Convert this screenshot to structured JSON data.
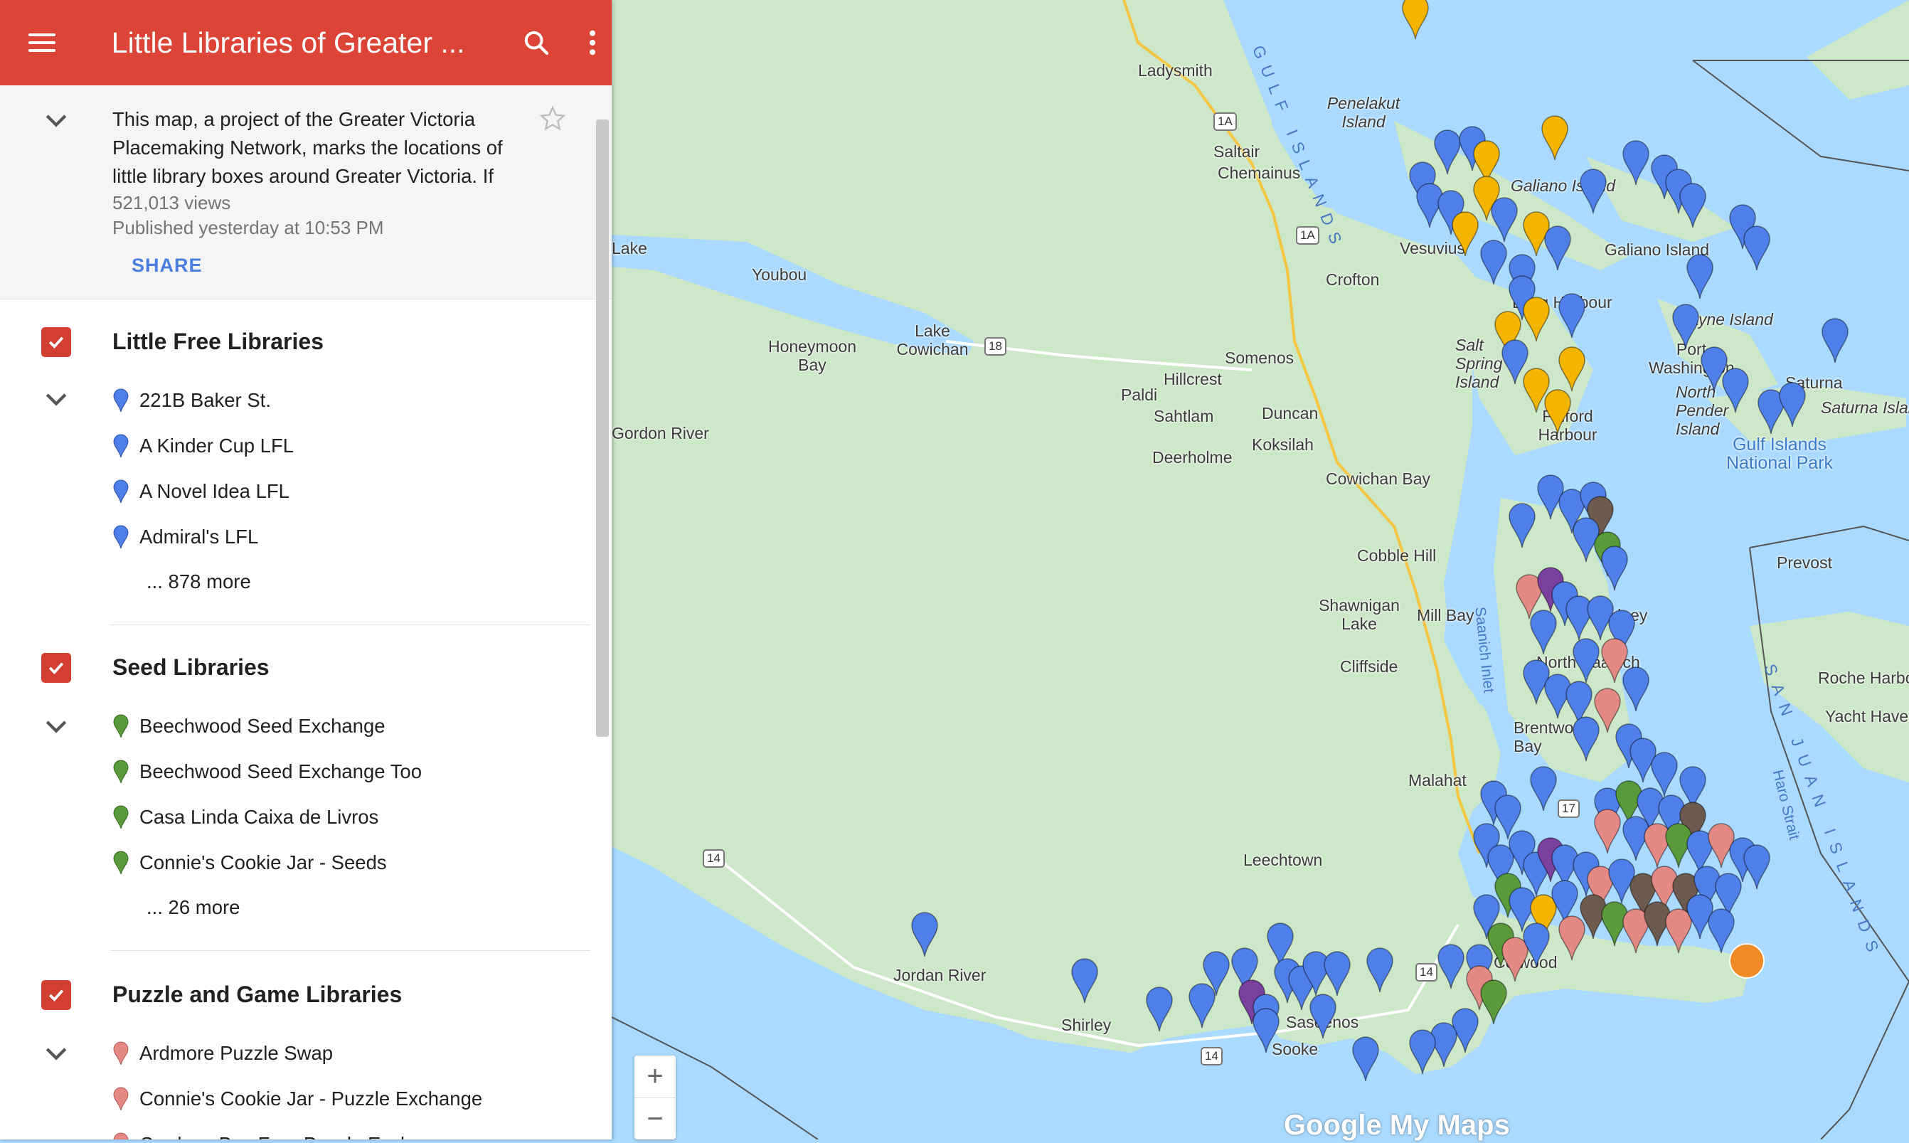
{
  "header": {
    "title": "Little Libraries of Greater ..."
  },
  "description": {
    "text": "This map, a project of the Greater Victoria Placemaking Network, marks the locations of little library boxes around Greater Victoria. If",
    "views": "521,013 views",
    "published": "Published yesterday at 10:53 PM",
    "share_label": "SHARE"
  },
  "layers": [
    {
      "name": "Little Free Libraries",
      "color": "#4f7fe8",
      "items": [
        "221B Baker St.",
        "A Kinder Cup LFL",
        "A Novel Idea LFL",
        "Admiral's LFL"
      ],
      "more": "... 878 more"
    },
    {
      "name": "Seed Libraries",
      "color": "#5a9a3a",
      "items": [
        "Beechwood Seed Exchange",
        "Beechwood Seed Exchange Too",
        "Casa Linda Caixa de Livros",
        "Connie's Cookie Jar - Seeds"
      ],
      "more": "... 26 more"
    },
    {
      "name": "Puzzle and Game Libraries",
      "color": "#e48a85",
      "items": [
        "Ardmore Puzzle Swap",
        "Connie's Cookie Jar - Puzzle Exchange",
        "Cordova Bay Free Puzzle Exchange"
      ]
    }
  ],
  "map_labels": {
    "ladysmith": "Ladysmith",
    "penelakut": "Penelakut Island",
    "gulf_islands": "GULF ISLANDS",
    "saltair": "Saltair",
    "chemainus": "Chemainus",
    "galiano_island": "Galiano Island",
    "galiano_island_2": "Galiano Island",
    "vesuvius": "Vesuvius",
    "crofton": "Crofton",
    "long_harbour": "Long Harbour",
    "youbou": "Youbou",
    "lake_cowichan": "Lake Cowichan",
    "honeymoon_bay": "Honeymoon Bay",
    "mayne_island": "Mayne Island",
    "port_washington": "Port Washington",
    "saturna": "Saturna",
    "saturna_island": "Saturna Island",
    "somenos": "Somenos",
    "salt_spring": "Salt Spring Island",
    "hillcrest": "Hillcrest",
    "paldi": "Paldi",
    "north_pender": "North Pender Island",
    "fulford_harbour": "Fulford Harbour",
    "saltlam": "Sahtlam",
    "duncan": "Duncan",
    "koksilah": "Koksilah",
    "deerholme": "Deerholme",
    "gulf_islands_park": "Gulf Islands National Park",
    "cowichan_bay": "Cowichan Bay",
    "prevost": "Prevost",
    "cobble_hill": "Cobble Hill",
    "shawnigan": "Shawnigan Lake",
    "mill_bay": "Mill Bay",
    "saanich_inlet": "Saanich Inlet",
    "sidney": "Sidney",
    "cliffside": "Cliffside",
    "north_saanich": "North Saanich",
    "roche_harbor": "Roche Harbor",
    "yacht_haven": "Yacht Haven",
    "san_juan": "SAN JUAN ISLANDS",
    "brentwood": "Brentwood Bay",
    "haro_strait": "Haro Strait",
    "malahat": "Malahat",
    "leechtown": "Leechtown",
    "jordan_river": "Jordan River",
    "shirley": "Shirley",
    "sooke": "Sooke",
    "saseenos": "Saseenos",
    "colwood": "Colwood",
    "gordon_river": "Gordon River",
    "cowichan_lake_west": "Lake"
  },
  "highways": {
    "h1a": "1A",
    "h1a_2": "1A",
    "h18": "18",
    "h14": "14",
    "h14_2": "14",
    "h14_3": "14",
    "h17": "17"
  },
  "zoom": {
    "in": "+",
    "out": "−"
  },
  "logo": "Google My Maps",
  "colors": {
    "header": "#db4437",
    "blue_pin": "#4f7fe8",
    "green_pin": "#5a9a3a",
    "pink_pin": "#e48a85",
    "yellow_pin": "#f4b400",
    "brown_pin": "#6d5a4e",
    "purple_pin": "#7b3fa0",
    "water": "#aadaff",
    "land": "#cde8c8"
  }
}
